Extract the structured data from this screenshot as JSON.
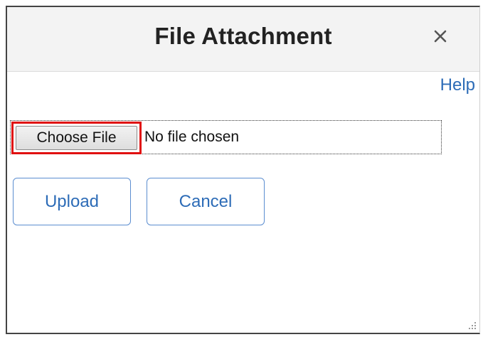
{
  "dialog": {
    "title": "File Attachment",
    "close_icon": "close-icon",
    "help_label": "Help"
  },
  "file_input": {
    "button_label": "Choose File",
    "status_text": "No file chosen",
    "highlight_color": "#e01010"
  },
  "actions": {
    "upload_label": "Upload",
    "cancel_label": "Cancel",
    "accent_color": "#2d6cb7"
  },
  "resize_icon": "resize-grip-icon"
}
